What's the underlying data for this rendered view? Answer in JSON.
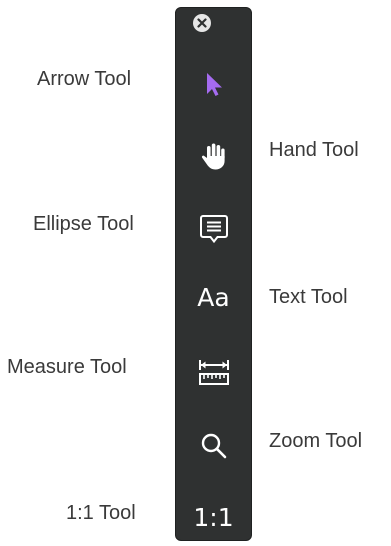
{
  "toolbar": {
    "close_icon": "close-icon",
    "tools": [
      {
        "id": "arrow",
        "label": "Arrow Tool",
        "icon": "arrow-cursor-icon",
        "accent": "#a56bf0"
      },
      {
        "id": "hand",
        "label": "Hand Tool",
        "icon": "hand-icon"
      },
      {
        "id": "ellipse",
        "label": "Ellipse Tool",
        "icon": "comment-bubble-icon"
      },
      {
        "id": "text",
        "label": "Text Tool",
        "icon": "text-aa-icon",
        "glyph": "Aa"
      },
      {
        "id": "measure",
        "label": "Measure Tool",
        "icon": "ruler-measure-icon"
      },
      {
        "id": "zoom",
        "label": "Zoom Tool",
        "icon": "magnifier-icon"
      },
      {
        "id": "one-to-one",
        "label": "1:1 Tool",
        "icon": "one-to-one-icon",
        "glyph": "1:1"
      }
    ]
  },
  "colors": {
    "toolbar_bg": "#2f3131",
    "label_text": "#3a3a3a",
    "icon": "#ffffff",
    "accent": "#a56bf0"
  }
}
